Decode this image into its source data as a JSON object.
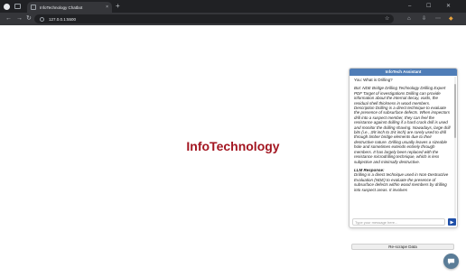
{
  "browser": {
    "tab_title": "InfoTechnology Chatbot",
    "tab_close": "×",
    "new_tab": "+",
    "url": "127.0.0.1:5500",
    "win_min": "–",
    "win_max": "☐",
    "win_close": "✕"
  },
  "page": {
    "brand": "InfoTechnology"
  },
  "chat": {
    "title": "InfoTech Assistant",
    "user_message": "You: What is Drilling?",
    "response_text": "Bot: NDE Bridge Drilling Technology Drilling Expert PDF Target of investigations Drilling can provide information about the internal decay, voids, the residual shell thickness in wood members. Description Drilling is a direct technique to evaluate the presence of subsurface defects. When inspectors drill into a suspect member, they can feel the resistance against drilling if a hard crack drill is used and monitor the drilling shaving. Nowadays, large drill bits (i.e., 3/8 inch to 3/4 inch) are rarely used to drill through timber bridge elements due to their destructive nature. Drilling usually leaves a sizeable hole and sometimes extends entirely through members. It has largely been replaced with the resistance microdrilling technique, which is less subjective and minimally destructive.",
    "llm_heading": "LLM Response:",
    "llm_text": "Drilling is a direct technique used in Non-Destructive Evaluation (NDE) to evaluate the presence of subsurface defects within wood members by drilling into suspect areas. It involves",
    "input_placeholder": "Type your message here...",
    "rescrape_label": "Re-scrape Data"
  },
  "colors": {
    "brand": "#a31621",
    "chat_header": "#4f7db7",
    "send_button": "#1f4fa8",
    "fab": "#5a7c97"
  }
}
